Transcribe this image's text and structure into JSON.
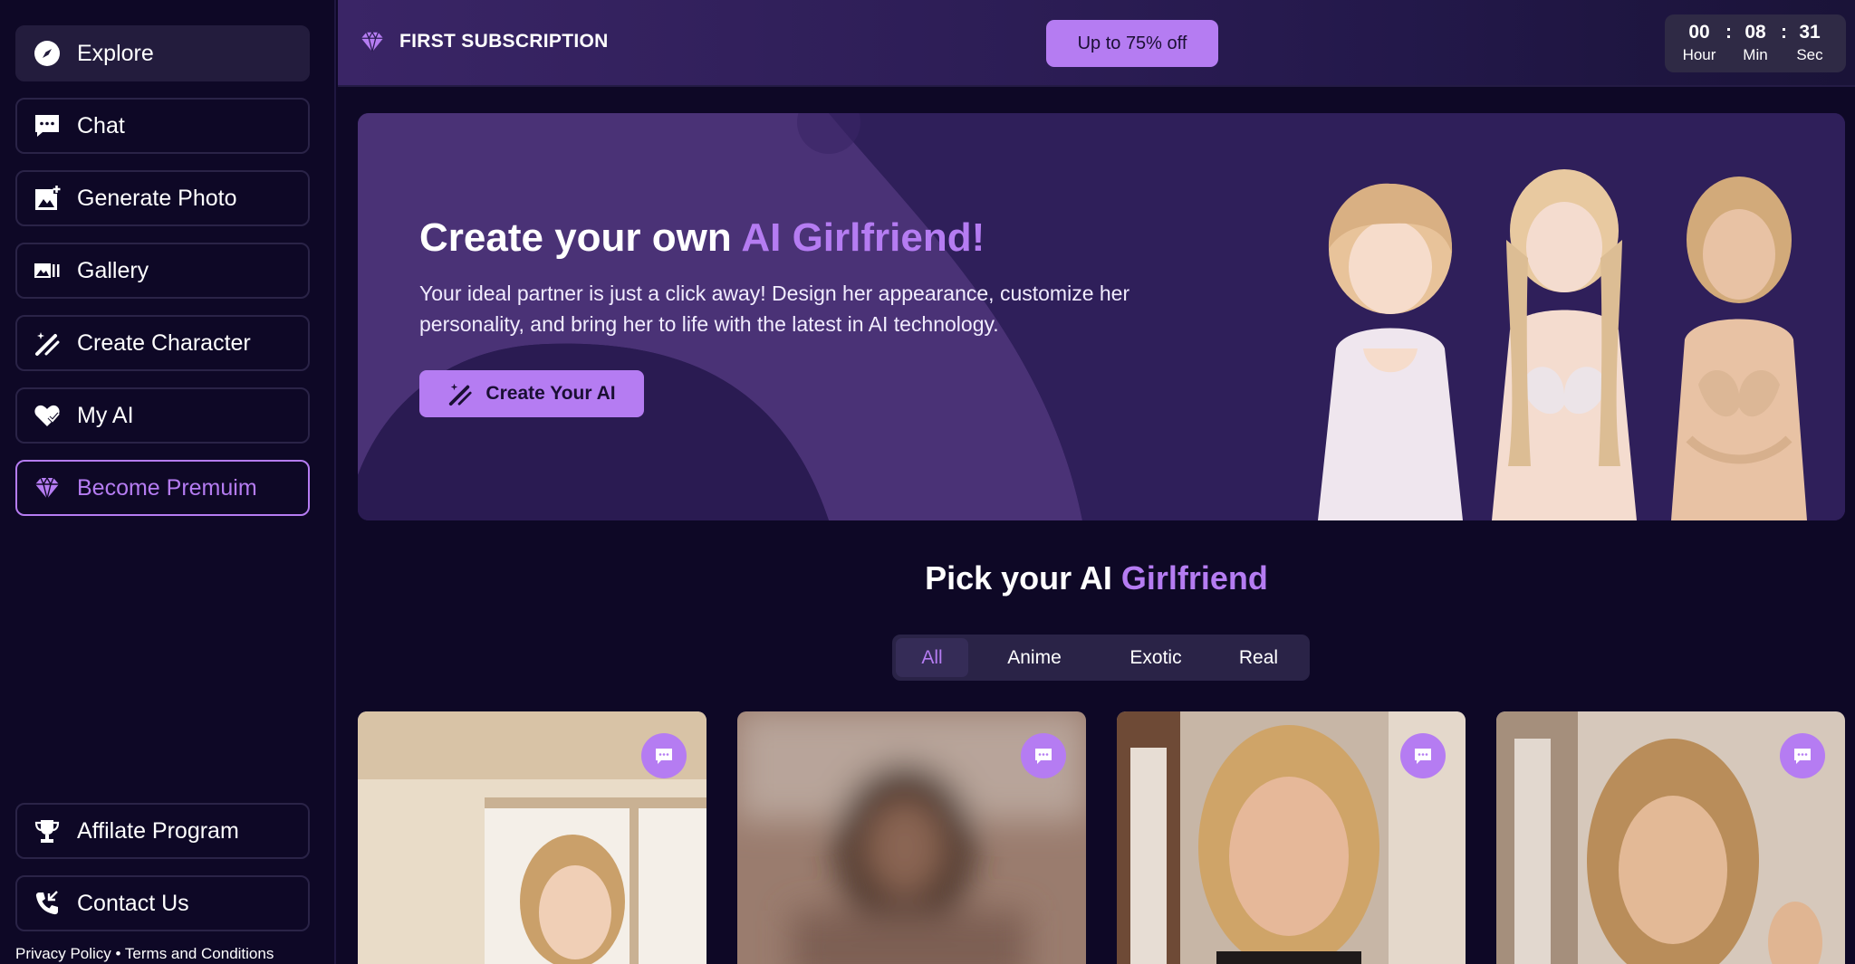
{
  "sidebar": {
    "items": [
      {
        "label": "Explore",
        "icon": "compass-icon"
      },
      {
        "label": "Chat",
        "icon": "chat-icon"
      },
      {
        "label": "Generate Photo",
        "icon": "image-plus-icon"
      },
      {
        "label": "Gallery",
        "icon": "gallery-icon"
      },
      {
        "label": "Create Character",
        "icon": "magic-wand-icon"
      },
      {
        "label": "My AI",
        "icon": "heart-check-icon"
      },
      {
        "label": "Become Premuim",
        "icon": "diamond-icon"
      }
    ],
    "bottom_items": [
      {
        "label": "Affilate Program",
        "icon": "trophy-icon"
      },
      {
        "label": "Contact Us",
        "icon": "phone-icon"
      }
    ],
    "footer": {
      "privacy": "Privacy Policy",
      "separator": "•",
      "terms": "Terms and Conditions"
    }
  },
  "topbar": {
    "promo_label": "FIRST SUBSCRIPTION",
    "promo_button": "Up to 75% off",
    "timer": {
      "hours": "00",
      "minutes": "08",
      "seconds": "31",
      "hour_label": "Hour",
      "min_label": "Min",
      "sec_label": "Sec",
      "separator": ":"
    }
  },
  "hero": {
    "title_prefix": "Create your own",
    "title_accent": "AI Girlfriend!",
    "description": "Your ideal partner is just a click away! Design her appearance, customize her personality, and bring her to life with the latest in AI technology.",
    "button_label": "Create Your AI"
  },
  "section": {
    "title_prefix": "Pick your AI",
    "title_accent": "Girlfriend",
    "tabs": [
      {
        "label": "All",
        "active": true
      },
      {
        "label": "Anime",
        "active": false
      },
      {
        "label": "Exotic",
        "active": false
      },
      {
        "label": "Real",
        "active": false
      }
    ]
  },
  "colors": {
    "accent": "#b57cf2",
    "background": "#0e0826",
    "hero_background": "#2a1b52"
  }
}
